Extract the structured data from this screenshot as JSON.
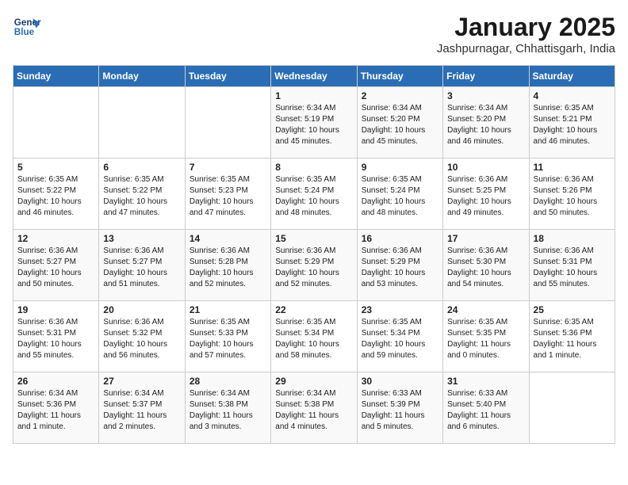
{
  "header": {
    "logo_line1": "General",
    "logo_line2": "Blue",
    "title": "January 2025",
    "subtitle": "Jashpurnagar, Chhattisgarh, India"
  },
  "days_of_week": [
    "Sunday",
    "Monday",
    "Tuesday",
    "Wednesday",
    "Thursday",
    "Friday",
    "Saturday"
  ],
  "weeks": [
    [
      {
        "day": "",
        "content": ""
      },
      {
        "day": "",
        "content": ""
      },
      {
        "day": "",
        "content": ""
      },
      {
        "day": "1",
        "content": "Sunrise: 6:34 AM\nSunset: 5:19 PM\nDaylight: 10 hours and 45 minutes."
      },
      {
        "day": "2",
        "content": "Sunrise: 6:34 AM\nSunset: 5:20 PM\nDaylight: 10 hours and 45 minutes."
      },
      {
        "day": "3",
        "content": "Sunrise: 6:34 AM\nSunset: 5:20 PM\nDaylight: 10 hours and 46 minutes."
      },
      {
        "day": "4",
        "content": "Sunrise: 6:35 AM\nSunset: 5:21 PM\nDaylight: 10 hours and 46 minutes."
      }
    ],
    [
      {
        "day": "5",
        "content": "Sunrise: 6:35 AM\nSunset: 5:22 PM\nDaylight: 10 hours and 46 minutes."
      },
      {
        "day": "6",
        "content": "Sunrise: 6:35 AM\nSunset: 5:22 PM\nDaylight: 10 hours and 47 minutes."
      },
      {
        "day": "7",
        "content": "Sunrise: 6:35 AM\nSunset: 5:23 PM\nDaylight: 10 hours and 47 minutes."
      },
      {
        "day": "8",
        "content": "Sunrise: 6:35 AM\nSunset: 5:24 PM\nDaylight: 10 hours and 48 minutes."
      },
      {
        "day": "9",
        "content": "Sunrise: 6:35 AM\nSunset: 5:24 PM\nDaylight: 10 hours and 48 minutes."
      },
      {
        "day": "10",
        "content": "Sunrise: 6:36 AM\nSunset: 5:25 PM\nDaylight: 10 hours and 49 minutes."
      },
      {
        "day": "11",
        "content": "Sunrise: 6:36 AM\nSunset: 5:26 PM\nDaylight: 10 hours and 50 minutes."
      }
    ],
    [
      {
        "day": "12",
        "content": "Sunrise: 6:36 AM\nSunset: 5:27 PM\nDaylight: 10 hours and 50 minutes."
      },
      {
        "day": "13",
        "content": "Sunrise: 6:36 AM\nSunset: 5:27 PM\nDaylight: 10 hours and 51 minutes."
      },
      {
        "day": "14",
        "content": "Sunrise: 6:36 AM\nSunset: 5:28 PM\nDaylight: 10 hours and 52 minutes."
      },
      {
        "day": "15",
        "content": "Sunrise: 6:36 AM\nSunset: 5:29 PM\nDaylight: 10 hours and 52 minutes."
      },
      {
        "day": "16",
        "content": "Sunrise: 6:36 AM\nSunset: 5:29 PM\nDaylight: 10 hours and 53 minutes."
      },
      {
        "day": "17",
        "content": "Sunrise: 6:36 AM\nSunset: 5:30 PM\nDaylight: 10 hours and 54 minutes."
      },
      {
        "day": "18",
        "content": "Sunrise: 6:36 AM\nSunset: 5:31 PM\nDaylight: 10 hours and 55 minutes."
      }
    ],
    [
      {
        "day": "19",
        "content": "Sunrise: 6:36 AM\nSunset: 5:31 PM\nDaylight: 10 hours and 55 minutes."
      },
      {
        "day": "20",
        "content": "Sunrise: 6:36 AM\nSunset: 5:32 PM\nDaylight: 10 hours and 56 minutes."
      },
      {
        "day": "21",
        "content": "Sunrise: 6:35 AM\nSunset: 5:33 PM\nDaylight: 10 hours and 57 minutes."
      },
      {
        "day": "22",
        "content": "Sunrise: 6:35 AM\nSunset: 5:34 PM\nDaylight: 10 hours and 58 minutes."
      },
      {
        "day": "23",
        "content": "Sunrise: 6:35 AM\nSunset: 5:34 PM\nDaylight: 10 hours and 59 minutes."
      },
      {
        "day": "24",
        "content": "Sunrise: 6:35 AM\nSunset: 5:35 PM\nDaylight: 11 hours and 0 minutes."
      },
      {
        "day": "25",
        "content": "Sunrise: 6:35 AM\nSunset: 5:36 PM\nDaylight: 11 hours and 1 minute."
      }
    ],
    [
      {
        "day": "26",
        "content": "Sunrise: 6:34 AM\nSunset: 5:36 PM\nDaylight: 11 hours and 1 minute."
      },
      {
        "day": "27",
        "content": "Sunrise: 6:34 AM\nSunset: 5:37 PM\nDaylight: 11 hours and 2 minutes."
      },
      {
        "day": "28",
        "content": "Sunrise: 6:34 AM\nSunset: 5:38 PM\nDaylight: 11 hours and 3 minutes."
      },
      {
        "day": "29",
        "content": "Sunrise: 6:34 AM\nSunset: 5:38 PM\nDaylight: 11 hours and 4 minutes."
      },
      {
        "day": "30",
        "content": "Sunrise: 6:33 AM\nSunset: 5:39 PM\nDaylight: 11 hours and 5 minutes."
      },
      {
        "day": "31",
        "content": "Sunrise: 6:33 AM\nSunset: 5:40 PM\nDaylight: 11 hours and 6 minutes."
      },
      {
        "day": "",
        "content": ""
      }
    ]
  ]
}
